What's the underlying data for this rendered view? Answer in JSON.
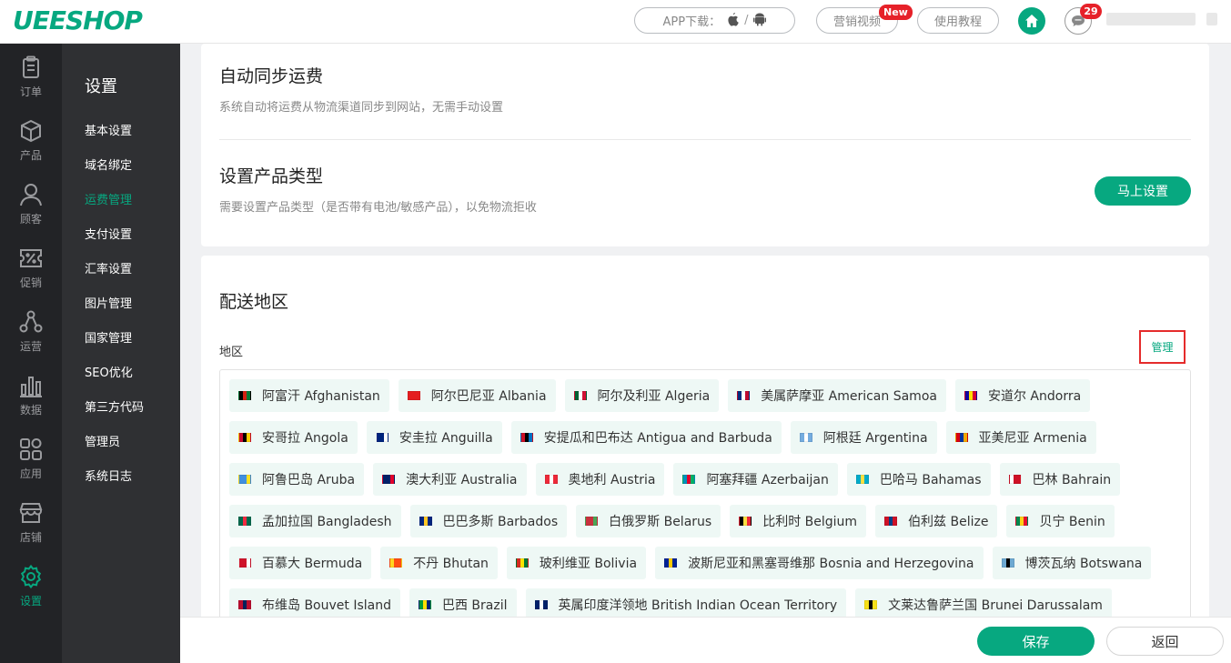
{
  "brand": {
    "logo": "UEESHOP",
    "accent": "#07a880"
  },
  "header": {
    "app_download_label": "APP下载：",
    "app_separator": "/",
    "marketing_video": "营销视频",
    "new_badge": "New",
    "tutorial": "使用教程",
    "message_count": "29"
  },
  "nav": [
    {
      "label": "订单",
      "icon": "clipboard-icon"
    },
    {
      "label": "产品",
      "icon": "cube-icon"
    },
    {
      "label": "顾客",
      "icon": "user-icon"
    },
    {
      "label": "促销",
      "icon": "percent-icon"
    },
    {
      "label": "运营",
      "icon": "network-icon"
    },
    {
      "label": "数据",
      "icon": "bar-chart-icon"
    },
    {
      "label": "应用",
      "icon": "apps-icon"
    },
    {
      "label": "店铺",
      "icon": "store-icon"
    },
    {
      "label": "设置",
      "icon": "gear-icon",
      "active": true
    }
  ],
  "submenu": {
    "title": "设置",
    "items": [
      "基本设置",
      "域名绑定",
      "运费管理",
      "支付设置",
      "汇率设置",
      "图片管理",
      "国家管理",
      "SEO优化",
      "第三方代码",
      "管理员",
      "系统日志"
    ],
    "active_index": 2
  },
  "sections": {
    "sync_title": "自动同步运费",
    "sync_desc": "系统自动将运费从物流渠道同步到网站，无需手动设置",
    "product_type_title": "设置产品类型",
    "product_type_desc": "需要设置产品类型（是否带有电池/敏感产品），以免物流拒收",
    "setup_button": "马上设置"
  },
  "shipping": {
    "title": "配送地区",
    "region_label": "地区",
    "manage_link": "管理",
    "countries": [
      {
        "name": "阿富汗  Afghanistan",
        "flag": [
          "#000000",
          "#d32011",
          "#007a36"
        ]
      },
      {
        "name": "阿尔巴尼亚  Albania",
        "flag": [
          "#e41e20",
          "#e41e20",
          "#e41e20"
        ]
      },
      {
        "name": "阿尔及利亚  Algeria",
        "flag": [
          "#006233",
          "#ffffff",
          "#d21034"
        ]
      },
      {
        "name": "美属萨摩亚  American Samoa",
        "flag": [
          "#002b7f",
          "#ffffff",
          "#bf0a30"
        ]
      },
      {
        "name": "安道尔  Andorra",
        "flag": [
          "#10069f",
          "#fedd00",
          "#d50032"
        ]
      },
      {
        "name": "安哥拉  Angola",
        "flag": [
          "#cc092f",
          "#000000",
          "#ffcb00"
        ]
      },
      {
        "name": "安圭拉  Anguilla",
        "flag": [
          "#00247d",
          "#00247d",
          "#ffffff"
        ]
      },
      {
        "name": "安提瓜和巴布达  Antigua and Barbuda",
        "flag": [
          "#ce1126",
          "#000000",
          "#0072c6"
        ]
      },
      {
        "name": "阿根廷  Argentina",
        "flag": [
          "#74acdf",
          "#ffffff",
          "#74acdf"
        ]
      },
      {
        "name": "亚美尼亚  Armenia",
        "flag": [
          "#d90012",
          "#0033a0",
          "#f2a800"
        ]
      },
      {
        "name": "阿鲁巴岛  Aruba",
        "flag": [
          "#418fde",
          "#418fde",
          "#fbe122"
        ]
      },
      {
        "name": "澳大利亚  Australia",
        "flag": [
          "#012169",
          "#012169",
          "#e4002b"
        ]
      },
      {
        "name": "奥地利  Austria",
        "flag": [
          "#ed2939",
          "#ffffff",
          "#ed2939"
        ]
      },
      {
        "name": "阿塞拜疆  Azerbaijan",
        "flag": [
          "#0092bc",
          "#e4002b",
          "#00af66"
        ]
      },
      {
        "name": "巴哈马  Bahamas",
        "flag": [
          "#00abc9",
          "#fae042",
          "#00abc9"
        ]
      },
      {
        "name": "巴林  Bahrain",
        "flag": [
          "#ffffff",
          "#ce1126",
          "#ce1126"
        ]
      },
      {
        "name": "孟加拉国  Bangladesh",
        "flag": [
          "#006a4e",
          "#f42a41",
          "#006a4e"
        ]
      },
      {
        "name": "巴巴多斯  Barbados",
        "flag": [
          "#00267f",
          "#ffc726",
          "#00267f"
        ]
      },
      {
        "name": "白俄罗斯  Belarus",
        "flag": [
          "#c8313e",
          "#c8313e",
          "#4aa657"
        ]
      },
      {
        "name": "比利时  Belgium",
        "flag": [
          "#000000",
          "#fae042",
          "#ed2939"
        ]
      },
      {
        "name": "伯利兹  Belize",
        "flag": [
          "#ce1126",
          "#003f87",
          "#ce1126"
        ]
      },
      {
        "name": "贝宁  Benin",
        "flag": [
          "#008751",
          "#fcd116",
          "#e8112d"
        ]
      },
      {
        "name": "百慕大  Bermuda",
        "flag": [
          "#cf142b",
          "#cf142b",
          "#ffffff"
        ]
      },
      {
        "name": "不丹  Bhutan",
        "flag": [
          "#ffd520",
          "#ff4e12",
          "#ff4e12"
        ]
      },
      {
        "name": "玻利维亚  Bolivia",
        "flag": [
          "#d52b1e",
          "#f9e300",
          "#007934"
        ]
      },
      {
        "name": "波斯尼亚和黑塞哥维那  Bosnia and Herzegovina",
        "flag": [
          "#002395",
          "#fecb00",
          "#002395"
        ]
      },
      {
        "name": "博茨瓦纳  Botswana",
        "flag": [
          "#6da9d2",
          "#000000",
          "#6da9d2"
        ]
      },
      {
        "name": "布维岛  Bouvet Island",
        "flag": [
          "#ba0c2f",
          "#00205b",
          "#ba0c2f"
        ]
      },
      {
        "name": "巴西  Brazil",
        "flag": [
          "#009c3b",
          "#ffdf00",
          "#002776"
        ]
      },
      {
        "name": "英属印度洋领地  British Indian Ocean Territory",
        "flag": [
          "#012169",
          "#ffffff",
          "#012169"
        ]
      },
      {
        "name": "文莱达鲁萨兰国  Brunei Darussalam",
        "flag": [
          "#f7e017",
          "#000000",
          "#f7e017"
        ]
      }
    ]
  },
  "footer": {
    "save": "保存",
    "back": "返回"
  }
}
